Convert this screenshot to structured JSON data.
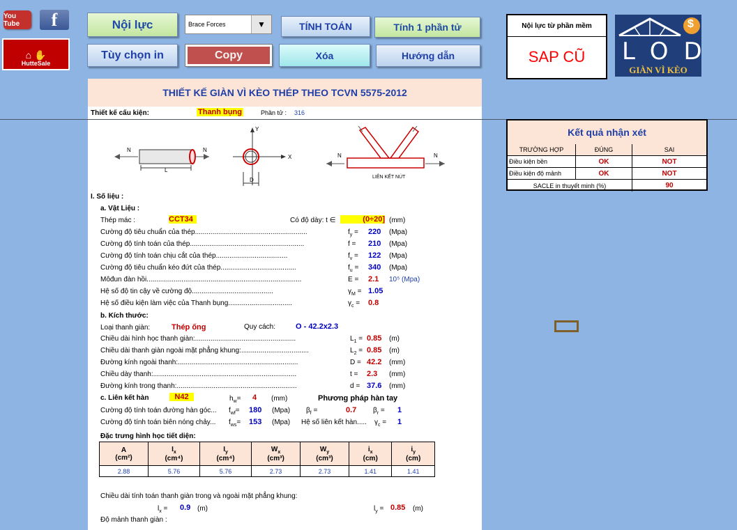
{
  "social": {
    "youtube": "You Tube",
    "hutte": "HutteSale"
  },
  "toolbar": {
    "noi_luc": "Nội lực",
    "tuy_chon_in": "Tùy chọn in",
    "dropdown_value": "Brace Forces",
    "copy": "Copy",
    "tinh_toan": "TÍNH TOÁN",
    "xoa": "Xóa",
    "tinh_1_phan_tu": "Tính 1 phần tử",
    "huong_dan": "Hướng dẫn"
  },
  "software_box": {
    "title": "Nội lực từ phần mềm",
    "value": "SAP CŨ"
  },
  "logo": {
    "letters": "LOD",
    "subtitle": "GIÀN VÌ KÈO",
    "dollar": "$"
  },
  "result": {
    "title": "Kết quả nhận xét",
    "headers": [
      "TRƯỜNG HỢP",
      "ĐÚNG",
      "SAI"
    ],
    "rows": [
      {
        "label": "Điều kiện bền",
        "ok": "OK",
        "not": "NOT"
      },
      {
        "label": "Điều kiện độ mảnh",
        "ok": "OK",
        "not": "NOT"
      }
    ],
    "scale_label": "SACLE in thuyết minh (%)",
    "scale_value": "90"
  },
  "sheet": {
    "title": "THIẾT KẾ GIÀN VÌ KÈO THÉP THEO TCVN 5575-2012",
    "component_label": "Thiết kế cấu kiện:",
    "component_value": "Thanh bụng",
    "element_label": "Phần tử :",
    "element_value": "316",
    "diag": {
      "N": "N",
      "L": "L",
      "Y": "Y",
      "X": "X",
      "D": "D",
      "lien_ket": "LIÊN KẾT NÚT"
    },
    "section1": "I.  Số liệu :",
    "material_title": "a. Vật Liệu :",
    "steel_label": "Thép mác :",
    "steel_value": "CCT34",
    "thickness_label": "Có độ dày:  t ∈",
    "thickness_value": "(0÷20]",
    "thickness_unit": "(mm)",
    "materials": [
      {
        "label": "Cường độ tiêu chuẩn của thép..........................................................",
        "sym": "f",
        "sub": "y",
        "val": "220",
        "unit": "(Mpa)",
        "color": "blue"
      },
      {
        "label": "Cường độ tính toán của thép...........................................................",
        "sym": "f",
        "sub": "",
        "val": "210",
        "unit": "(Mpa)",
        "color": "blue"
      },
      {
        "label": "Cường độ tính toán chịu cắt của thép.....................................",
        "sym": "f",
        "sub": "v",
        "val": "122",
        "unit": "(Mpa)",
        "color": "blue"
      },
      {
        "label": "Cường độ tiêu chuẩn kéo đứt của thép.......................................",
        "sym": "f",
        "sub": "u",
        "val": "340",
        "unit": "(Mpa)",
        "color": "blue"
      },
      {
        "label": "Môđun đàn hồi................................................................................",
        "sym": "E",
        "sub": "",
        "val": "2.1",
        "unit": "10⁵ (Mpa)",
        "color": "red"
      },
      {
        "label": "Hệ số độ tin cậy về cường độ..........................................",
        "sym": "γ",
        "sub": "M",
        "val": "1.05",
        "unit": "",
        "color": "blue"
      },
      {
        "label": "Hệ số điều kiện làm việc của Thanh bụng.................................",
        "sym": "γ",
        "sub": "c",
        "val": "0.8",
        "unit": "",
        "color": "red"
      }
    ],
    "dims_title": "b. Kích thước:",
    "bar_type_label": "Loại thanh giàn:",
    "bar_type_value": "Thép ống",
    "spec_label": "Quy cách:",
    "spec_value": "O - 42.2x2.3",
    "dims": [
      {
        "label": "Chiều dài hình học thanh giàn:....................................................",
        "sym": "L",
        "sub": "1",
        "val": "0.85",
        "unit": "(m)",
        "color": "red"
      },
      {
        "label": "Chiều dài thanh giàn ngoài mặt phẳng khung:...................................",
        "sym": "L",
        "sub": "2",
        "val": "0.85",
        "unit": "(m)",
        "color": "red"
      },
      {
        "label": "Đường kính ngoài thanh:..............................................................",
        "sym": "D",
        "sub": "",
        "val": "42.2",
        "unit": "(mm)",
        "color": "red"
      },
      {
        "label": "Chiều dày thanh:..........................................................................",
        "sym": "t",
        "sub": "",
        "val": "2.3",
        "unit": "(mm)",
        "color": "red"
      },
      {
        "label": "Đường kính trong thanh:..............................................................",
        "sym": "d",
        "sub": "",
        "val": "37.6",
        "unit": "(mm)",
        "color": "blue"
      }
    ],
    "weld_title": "c. Liên kết hàn",
    "weld_value": "N42",
    "hw_sym": "h",
    "hw_sub": "w",
    "hw_val": "4",
    "hw_unit": "(mm)",
    "weld_method": "Phương pháp hàn tay",
    "weld_rows": [
      {
        "label": "Cường độ tính toán đường hàn góc...",
        "sym": "f",
        "sub": "wf",
        "val": "180",
        "unit": "(Mpa)",
        "b_sym": "β",
        "b_sub": "f",
        "b_val": "0.7",
        "c_sym": "β",
        "c_sub": "r",
        "c_val": "1"
      },
      {
        "label": "Cường độ tính toán biên nóng chảy...",
        "sym": "f",
        "sub": "ws",
        "val": "153",
        "unit": "(Mpa)",
        "b_label": "Hệ số liên kết hàn.....",
        "c_sym": "γ",
        "c_sub": "c",
        "c_val": "1"
      }
    ],
    "section_props_title": "Đặc trưng hình học tiết diện:",
    "props_headers": [
      {
        "sym": "A",
        "unit": "(cm²)"
      },
      {
        "sym": "I",
        "sub": "x",
        "unit": "(cm⁴)"
      },
      {
        "sym": "I",
        "sub": "y",
        "unit": "(cm⁴)"
      },
      {
        "sym": "W",
        "sub": "x",
        "unit": "(cm³)"
      },
      {
        "sym": "W",
        "sub": "y",
        "unit": "(cm³)"
      },
      {
        "sym": "i",
        "sub": "x",
        "unit": "(cm)"
      },
      {
        "sym": "i",
        "sub": "y",
        "unit": "(cm)"
      }
    ],
    "props_values": [
      "2.88",
      "5.76",
      "5.76",
      "2.73",
      "2.73",
      "1.41",
      "1.41"
    ],
    "calc_len_label": "Chiều dài tính toán thanh giàn trong và ngoài mặt phẳng khung:",
    "lx_sym": "l",
    "lx_sub": "x",
    "lx_val": "0.9",
    "lx_unit": "(m)",
    "ly_sym": "l",
    "ly_sub": "y",
    "ly_val": "0.85",
    "ly_unit": "(m)",
    "slender_label": "Độ mảnh thanh giàn :"
  },
  "colors": {
    "background": "#8db4e2",
    "header_bg": "#fce4d6",
    "accent_red": "#c00000",
    "accent_blue": "#0000c0"
  }
}
